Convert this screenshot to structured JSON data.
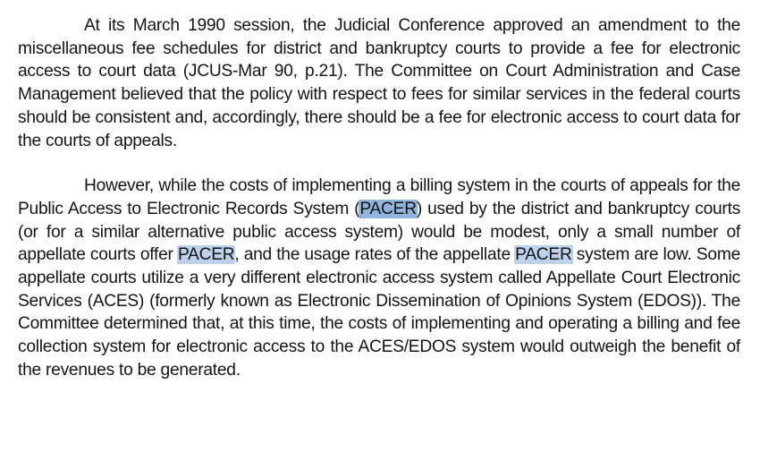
{
  "document": {
    "search_term": "PACER",
    "highlight_colors": {
      "active": "#8fb3da",
      "inactive": "#bcd2ea"
    },
    "paragraphs": [
      {
        "text": "At its March 1990 session, the Judicial Conference approved an amendment to the miscellaneous fee schedules for district and bankruptcy courts to provide a fee for electronic access to court data (JCUS-Mar 90, p.21).  The Committee on Court Administration and Case Management believed that the policy with respect to fees for similar services in the federal courts should be consistent and, accordingly, there should be a fee for electronic access to court data for the courts of appeals."
      },
      {
        "segments": [
          "However, while the costs of implementing a billing system in the courts of appeals for the Public Access to Electronic Records System (",
          "PACER",
          ") used by the district and bankruptcy courts (or for a similar alternative public access system) would be modest, only a small number of appellate courts offer ",
          "PACER",
          ", and the usage rates of the appellate ",
          "PACER",
          " system are low.  Some appellate courts utilize a very different electronic access system called Appellate Court Electronic Services (ACES) (formerly known as Electronic Dissemination of Opinions System (EDOS)). The Committee determined that, at this time, the costs of implementing and operating a billing and fee collection system for electronic access to the ACES/EDOS system would outweigh the benefit of the revenues to be generated."
        ]
      }
    ]
  }
}
